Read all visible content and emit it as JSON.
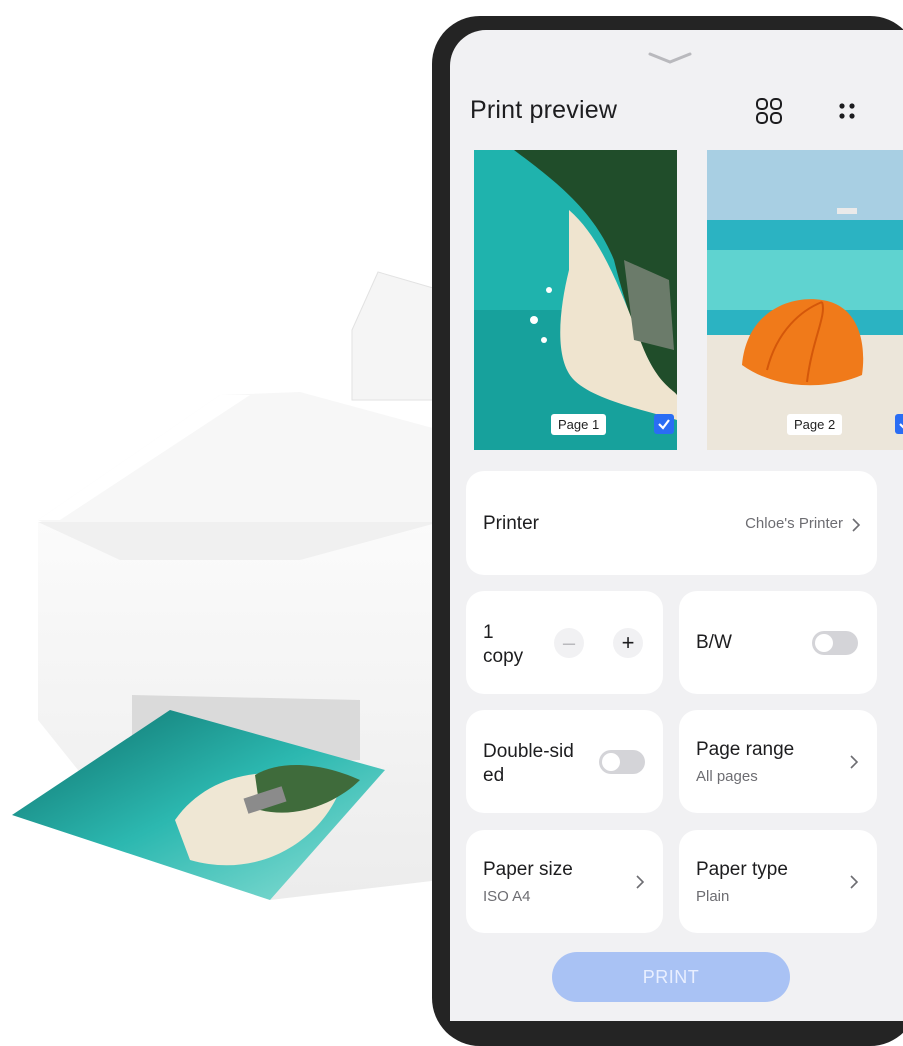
{
  "title": "Print preview",
  "icons": {
    "grid": "grid-view-icon",
    "more": "more-options-icon",
    "handle": "chevron-down-icon",
    "check": "checkmark-icon",
    "chevron": "chevron-right-icon"
  },
  "pages": [
    {
      "label": "Page 1",
      "selected": true
    },
    {
      "label": "Page 2",
      "selected": true
    }
  ],
  "printer": {
    "label": "Printer",
    "value": "Chloe's Printer"
  },
  "copies": {
    "count": "1",
    "unit": "copy",
    "minus": "–",
    "plus": "+"
  },
  "bw": {
    "label": "B/W",
    "on": false
  },
  "duplex": {
    "label": "Double-sided",
    "on": false
  },
  "page_range": {
    "label": "Page range",
    "value": "All pages"
  },
  "paper_size": {
    "label": "Paper size",
    "value": "ISO A4"
  },
  "paper_type": {
    "label": "Paper type",
    "value": "Plain"
  },
  "print_button": "PRINT",
  "colors": {
    "accent": "#2a6df4",
    "print_button": "#a9c2f4",
    "background": "#f1f1f3"
  }
}
